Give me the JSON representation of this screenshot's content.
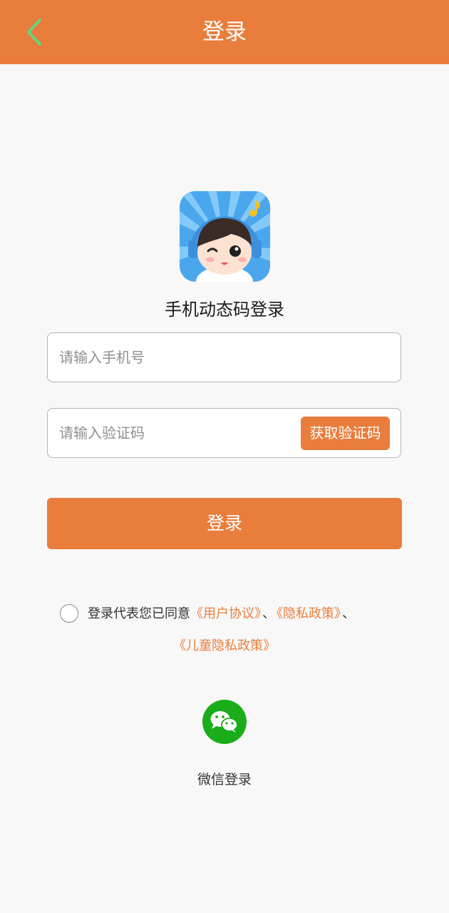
{
  "header": {
    "title": "登录",
    "back_icon": "chevron-left-icon",
    "back_color": "#63d57e",
    "background": "#e97d3c"
  },
  "logo": {
    "icon": "app-logo-icon"
  },
  "subtitle": "手机动态码登录",
  "phone": {
    "placeholder": "请输入手机号",
    "value": ""
  },
  "code": {
    "placeholder": "请输入验证码",
    "value": "",
    "get_code_label": "获取验证码"
  },
  "login_button": "登录",
  "agreement": {
    "checked": false,
    "prefix": "登录代表您已同意",
    "user_agreement": "《用户协议》",
    "separator1": "、",
    "privacy_policy": "《隐私政策》",
    "separator2": "、",
    "child_privacy_policy": "《儿童隐私政策》"
  },
  "wechat": {
    "icon": "wechat-icon",
    "label": "微信登录",
    "color": "#1aad19"
  },
  "accent_color": "#e97d3c"
}
